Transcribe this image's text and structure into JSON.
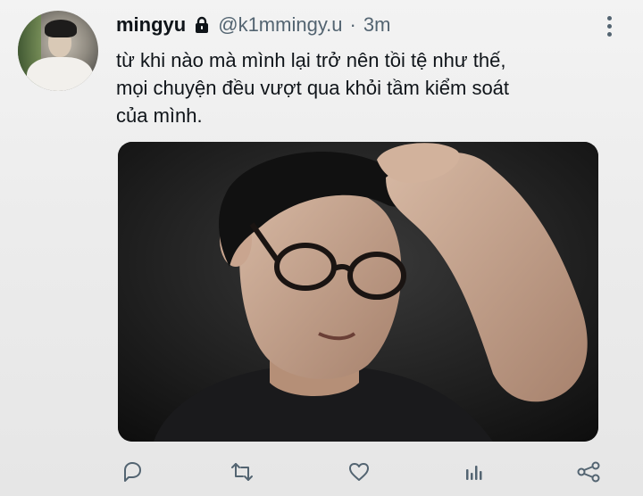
{
  "tweet": {
    "display_name": "mingyu",
    "handle": "@k1mmingy.u",
    "separator": "·",
    "time": "3m",
    "lines": [
      "từ khi nào mà mình lại trở nên tồi tệ như thế,",
      "mọi chuyện đều vượt qua khỏi tầm kiểm soát",
      "của mình."
    ]
  },
  "icons": {
    "lock": "lock-icon",
    "more": "more-vertical-icon",
    "reply": "reply-icon",
    "retweet": "retweet-icon",
    "like": "heart-icon",
    "analytics": "analytics-icon",
    "share": "share-icon"
  },
  "colors": {
    "text": "#0f1419",
    "secondary": "#536471"
  }
}
